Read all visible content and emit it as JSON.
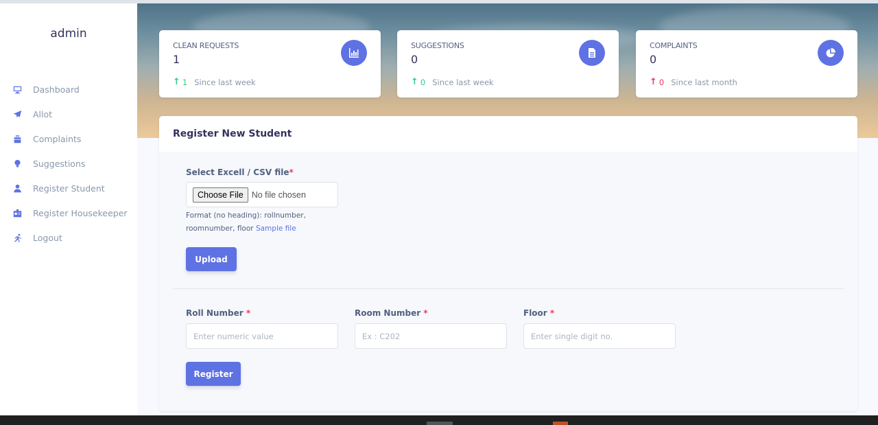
{
  "sidebar": {
    "brand": "admin",
    "items": [
      {
        "label": "Dashboard",
        "icon": "monitor-icon"
      },
      {
        "label": "Allot",
        "icon": "send-icon"
      },
      {
        "label": "Complaints",
        "icon": "briefcase-icon"
      },
      {
        "label": "Suggestions",
        "icon": "bulb-icon"
      },
      {
        "label": "Register Student",
        "icon": "user-icon"
      },
      {
        "label": "Register Housekeeper",
        "icon": "badge-icon"
      },
      {
        "label": "Logout",
        "icon": "running-icon"
      }
    ]
  },
  "stats": [
    {
      "title": "Clean Requests",
      "value": "1",
      "change": "1",
      "since": "Since last week",
      "trend": "up",
      "trend_color": "#2dce89",
      "icon": "bar-chart-icon"
    },
    {
      "title": "Suggestions",
      "value": "0",
      "change": "0",
      "since": "Since last week",
      "trend": "up",
      "trend_color": "#2dce89",
      "icon": "document-icon"
    },
    {
      "title": "Complaints",
      "value": "0",
      "change": "0",
      "since": "Since last month",
      "trend": "up",
      "trend_color": "#f5365c",
      "icon": "pie-chart-icon"
    }
  ],
  "form": {
    "title": "Register New Student",
    "file_label": "Select Excell / CSV file",
    "required_mark": "*",
    "file_button": "Choose File",
    "file_status": "No file chosen",
    "help_text": "Format (no heading): rollnumber, roomnumber, floor",
    "sample_link": "Sample file",
    "upload_button": "Upload",
    "roll_label": "Roll Number",
    "roll_placeholder": "Enter numeric value",
    "room_label": "Room Number",
    "room_placeholder": "Ex : C202",
    "floor_label": "Floor",
    "floor_placeholder": "Enter single digit no.",
    "register_button": "Register"
  },
  "colors": {
    "primary": "#5e72e4",
    "success": "#2dce89",
    "danger": "#f5365c"
  }
}
